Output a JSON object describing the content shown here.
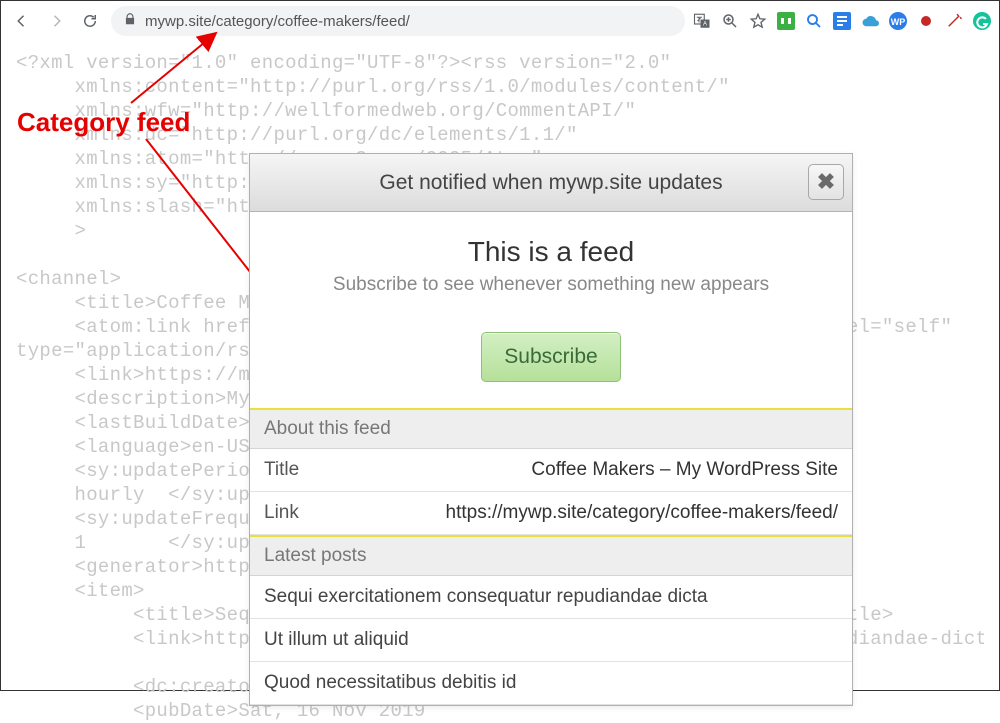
{
  "browser": {
    "url": "mywp.site/category/coffee-makers/feed/",
    "extension_hints": [
      "translate",
      "zoom",
      "star",
      "dashlane",
      "search",
      "docs",
      "cloud",
      "wp",
      "rec",
      "wand",
      "grammarly"
    ]
  },
  "annotation": {
    "label": "Category feed"
  },
  "xml_bg": "<?xml version=\"1.0\" encoding=\"UTF-8\"?><rss version=\"2.0\"\n     xmlns:content=\"http://purl.org/rss/1.0/modules/content/\"\n     xmlns:wfw=\"http://wellformedweb.org/CommentAPI/\"\n     xmlns:dc=\"http://purl.org/dc/elements/1.1/\"\n     xmlns:atom=\"http://www.w3.org/2005/Atom\"\n     xmlns:sy=\"http://purl.org/rss/1.0/modules/syndication/\n     xmlns:slash=\"http://purl.org/rss/1.0/modules/slash/\"\n     >\n\n<channel>\n     <title>Coffee Makers &#8211; My WordPress Site</title>\n     <atom:link href=\"https://mywp.site/category/coffee-makers/feed/\" rel=\"self\"\ntype=\"application/rss+xml\" />\n     <link>https://mywp.site</link>\n     <description>My WordPress Site</description>\n     <lastBuildDate>Wed, 20 Nov 2019</lastBuildDate>\n     <language>en-US</language>\n     <sy:updatePeriod>\n     hourly  </sy:updatePeriod>\n     <sy:updateFrequency>\n     1       </sy:updateFrequency>\n     <generator>https://wordpress.org/?v=5.3</generator>\n     <item>\n          <title>Sequi exercitationem consequatur repudiandae dicta</title>\n          <link>https://mywp.site/sequi-exercitationem-consequatur-repudiandae-dicta/</link>\n\n          <dc:creator><![CDATA[admin]]></dc:creator>\n          <pubDate>Sat, 16 Nov 2019",
  "dialog": {
    "header": "Get notified when mywp.site updates",
    "title": "This is a feed",
    "subtitle": "Subscribe to see whenever something new appears",
    "subscribe_label": "Subscribe",
    "about_head": "About this feed",
    "rows": {
      "title_key": "Title",
      "title_val": "Coffee Makers – My WordPress Site",
      "link_key": "Link",
      "link_val": "https://mywp.site/category/coffee-makers/feed/"
    },
    "latest_head": "Latest posts",
    "posts": [
      "Sequi exercitationem consequatur repudiandae dicta",
      "Ut illum ut aliquid",
      "Quod necessitatibus debitis id"
    ]
  }
}
